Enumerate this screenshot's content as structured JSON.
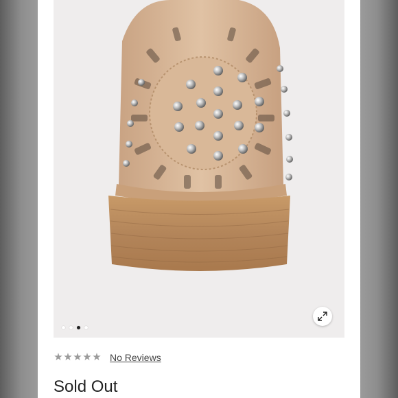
{
  "product": {
    "image": {
      "alt": "Studded perforated leather shoe, heel view",
      "pager": {
        "count": 4,
        "active_index": 2
      },
      "expand_icon": "expand-icon"
    },
    "rating": {
      "stars_filled": 0,
      "stars_total": 5,
      "star_glyph": "★",
      "star_color": "#9b9b9b",
      "reviews_label": "No Reviews"
    },
    "status": "Sold Out"
  },
  "colors": {
    "page_bg": "#ffffff",
    "image_bg": "#efeded",
    "leather": "#d6b597",
    "heel_wood": "#b88a5c",
    "text": "#222222"
  }
}
